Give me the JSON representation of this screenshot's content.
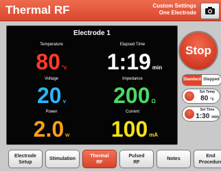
{
  "header": {
    "title": "Thermal RF",
    "custom_line1": "Custom Settings",
    "custom_line2": "One Electrode",
    "camera_icon": "camera-icon"
  },
  "panel": {
    "title": "Electrode 1",
    "temperature": {
      "label": "Temperature",
      "value": "80",
      "unit": "°c",
      "color": "#ff3b2b"
    },
    "elapsed": {
      "label": "Elapsed Time",
      "value": "1:19",
      "unit": "min",
      "color": "#ffffff"
    },
    "voltage": {
      "label": "Voltage",
      "value": "20",
      "unit": "v",
      "color": "#29b6f6"
    },
    "impedance": {
      "label": "Impedance",
      "value": "200",
      "unit": "Ω",
      "color": "#4cd964"
    },
    "power": {
      "label": "Power",
      "value": "2.0",
      "unit": "w",
      "color": "#ff9f1a"
    },
    "current": {
      "label": "Current",
      "value": "100",
      "unit": "mA",
      "color": "#f5e11a"
    }
  },
  "controls": {
    "stop_label": "Stop",
    "mode_standard": "Standard",
    "mode_stepped": "Stepped",
    "set_temp_label": "Set Temp",
    "set_temp_value": "80",
    "set_temp_unit": "°c",
    "set_time_label": "Set Time",
    "set_time_value": "1:30",
    "set_time_unit": "min"
  },
  "nav": {
    "electrode_setup": [
      "Electrode",
      "Setup"
    ],
    "stimulation": "Stimulation",
    "thermal_rf": [
      "Thermal",
      "RF"
    ],
    "pulsed_rf": [
      "Pulsed",
      "RF"
    ],
    "notes": "Notes",
    "end_procedure": [
      "End",
      "Procedure"
    ]
  },
  "colors": {
    "accent": "#e0452b"
  }
}
